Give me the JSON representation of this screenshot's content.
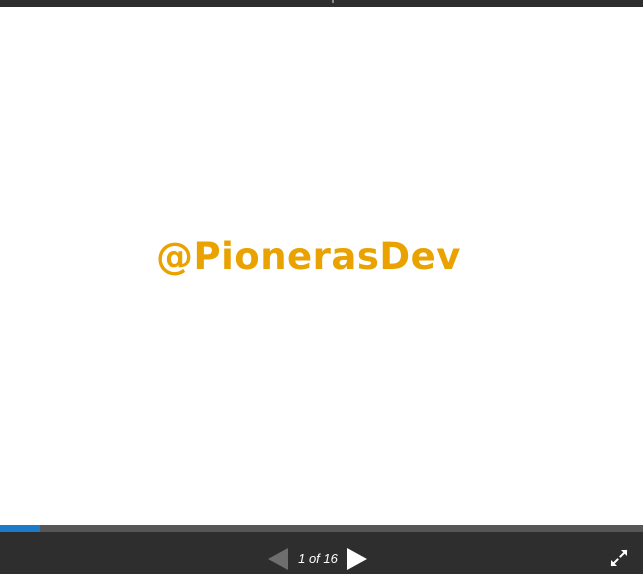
{
  "slide": {
    "text": "@PionerasDev",
    "text_color": "#e9a200"
  },
  "progress": {
    "fraction": 0.0625,
    "fill_color": "#1b7ac9"
  },
  "pagination": {
    "current": 1,
    "total": 16,
    "label": "1 of 16"
  },
  "controls": {
    "prev_icon": "triangle-left-icon",
    "next_icon": "triangle-right-icon",
    "fullscreen_icon": "expand-arrows-icon"
  }
}
